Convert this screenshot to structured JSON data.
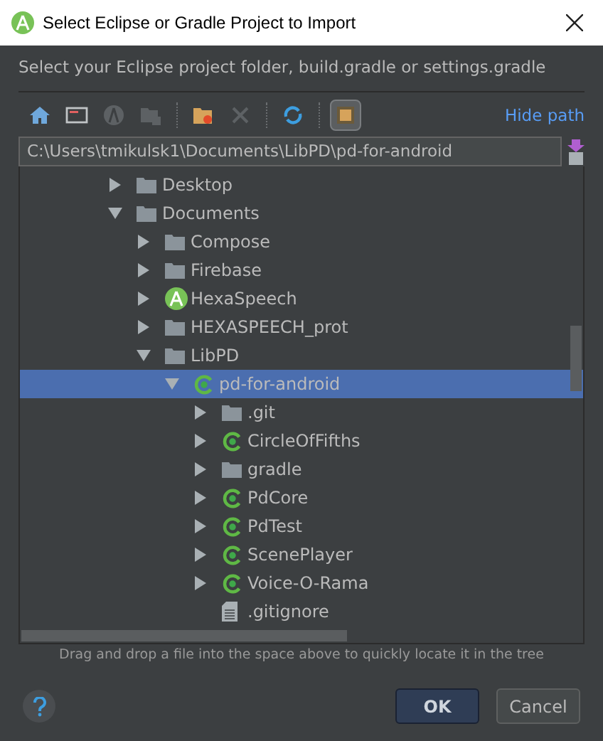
{
  "window": {
    "title": "Select Eclipse or Gradle Project to Import"
  },
  "instruction": "Select your Eclipse project folder, build.gradle or settings.gradle",
  "toolbar": [
    {
      "kind": "home",
      "disabled": false,
      "selected": false
    },
    {
      "kind": "desktop",
      "disabled": false,
      "selected": false
    },
    {
      "kind": "android",
      "disabled": true,
      "selected": false
    },
    {
      "kind": "module",
      "disabled": true,
      "selected": false
    },
    {
      "kind": "separator"
    },
    {
      "kind": "new-folder",
      "disabled": false,
      "selected": false
    },
    {
      "kind": "delete",
      "disabled": true,
      "selected": false
    },
    {
      "kind": "separator"
    },
    {
      "kind": "refresh",
      "disabled": false,
      "selected": false
    },
    {
      "kind": "separator"
    },
    {
      "kind": "show-hidden",
      "disabled": false,
      "selected": true
    }
  ],
  "hide_path_link": "Hide path",
  "path": "C:\\Users\\tmikulsk1\\Documents\\LibPD\\pd-for-android",
  "tree": [
    {
      "label": "Desktop",
      "kind": "folder",
      "expanded": false,
      "selected": false
    },
    {
      "label": "Documents",
      "kind": "folder",
      "expanded": true,
      "selected": false,
      "children": [
        {
          "label": "Compose",
          "kind": "folder",
          "expanded": false,
          "selected": false
        },
        {
          "label": "Firebase",
          "kind": "folder",
          "expanded": false,
          "selected": false
        },
        {
          "label": "HexaSpeech",
          "kind": "android",
          "expanded": false,
          "selected": false
        },
        {
          "label": "HEXASPEECH_prot",
          "kind": "folder",
          "expanded": false,
          "selected": false
        },
        {
          "label": "LibPD",
          "kind": "folder",
          "expanded": true,
          "selected": false,
          "children": [
            {
              "label": "pd-for-android",
              "kind": "module",
              "expanded": true,
              "selected": true,
              "children": [
                {
                  "label": ".git",
                  "kind": "folder",
                  "expanded": false,
                  "selected": false
                },
                {
                  "label": "CircleOfFifths",
                  "kind": "module",
                  "expanded": false,
                  "selected": false
                },
                {
                  "label": "gradle",
                  "kind": "folder",
                  "expanded": false,
                  "selected": false
                },
                {
                  "label": "PdCore",
                  "kind": "module",
                  "expanded": false,
                  "selected": false
                },
                {
                  "label": "PdTest",
                  "kind": "module",
                  "expanded": false,
                  "selected": false
                },
                {
                  "label": "ScenePlayer",
                  "kind": "module",
                  "expanded": false,
                  "selected": false
                },
                {
                  "label": "Voice-O-Rama",
                  "kind": "module",
                  "expanded": false,
                  "selected": false
                },
                {
                  "label": ".gitignore",
                  "kind": "file",
                  "selected": false
                }
              ]
            }
          ]
        }
      ]
    }
  ],
  "hint": "Drag and drop a file into the space above to quickly locate it in the tree",
  "buttons": [
    {
      "label": "OK",
      "kind": "primary"
    },
    {
      "label": "Cancel",
      "kind": "secondary"
    }
  ]
}
